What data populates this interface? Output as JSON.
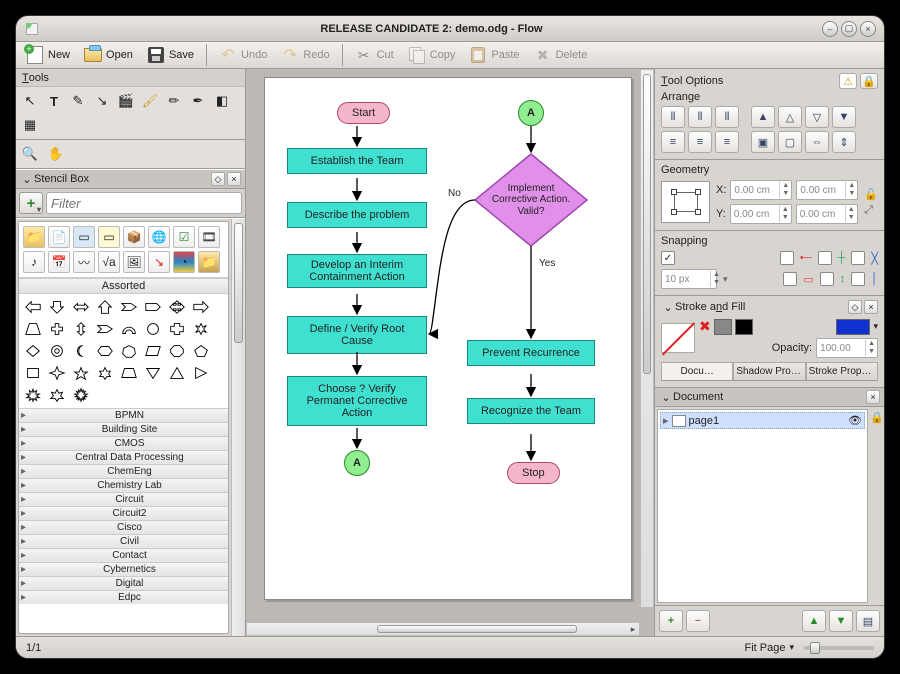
{
  "window": {
    "title": "RELEASE CANDIDATE 2: demo.odg - Flow"
  },
  "toolbar": {
    "new": "New",
    "open": "Open",
    "save": "Save",
    "undo": "Undo",
    "redo": "Redo",
    "cut": "Cut",
    "copy": "Copy",
    "paste": "Paste",
    "delete": "Delete"
  },
  "left": {
    "tools_title_lead": "T",
    "tools_title_rest": "ools",
    "stencil_title": "Stencil Box",
    "filter_placeholder": "Filter",
    "assorted_label": "Assorted",
    "categories": [
      "BPMN",
      "Building Site",
      "CMOS",
      "Central Data Processing",
      "ChemEng",
      "Chemistry Lab",
      "Circuit",
      "Circuit2",
      "Cisco",
      "Civil",
      "Contact",
      "Cybernetics",
      "Digital",
      "Edpc"
    ]
  },
  "flow": {
    "start": "Start",
    "p1": "Establish the Team",
    "p2": "Describe the problem",
    "p3": "Develop an Interim Containment Action",
    "p4": "Define / Verify Root Cause",
    "p5": "Choose ? Verify Permanet Corrective Action",
    "connA": "A",
    "connA2": "A",
    "decision": "Implement Corrective Action. Valid?",
    "no": "No",
    "yes": "Yes",
    "p6": "Prevent Recurrence",
    "p7": "Recognize the Team",
    "stop": "Stop"
  },
  "right": {
    "tool_options_lead": "T",
    "tool_options_rest": "ool Options",
    "arrange": "Arrange",
    "geometry": "Geometry",
    "x_label": "X:",
    "y_label": "Y:",
    "coord_x": "0.00 cm",
    "coord_y": "0.00 cm",
    "size_w": "0.00 cm",
    "size_h": "0.00 cm",
    "snapping": "Snapping",
    "snap_px": "10 px",
    "stroke_fill_lead": "Stroke a",
    "stroke_fill_mid": "n",
    "stroke_fill_rest": "d Fill",
    "opacity_label": "Opacity:",
    "opacity_value": "100.00",
    "tab_doc": "Docu…",
    "tab_shadow": "Shadow Proper…",
    "tab_stroke": "Stroke Proper…",
    "document_title": "Document",
    "page1": "page1"
  },
  "status": {
    "page": "1/1",
    "fit": "Fit Page"
  }
}
